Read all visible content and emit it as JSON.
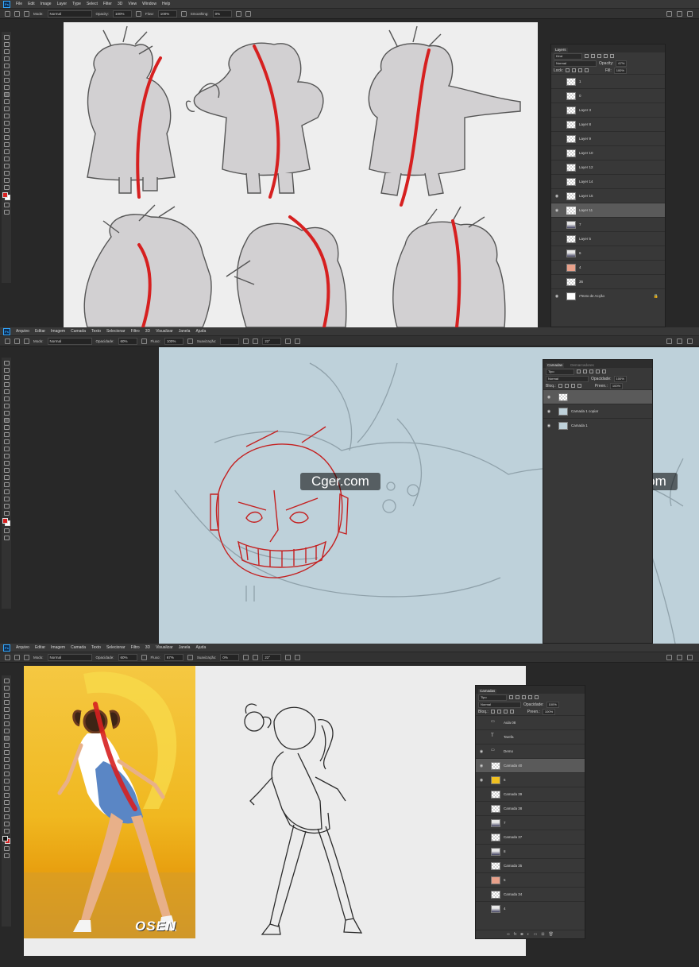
{
  "colors": {
    "ui_dark": "#282828",
    "ui_panel": "#383838",
    "canvas_light": "#eeeeee",
    "canvas_blue": "#bed1da",
    "accent_red": "#d62020",
    "photo_yellow": "#f2c120"
  },
  "panel1": {
    "menu": [
      "File",
      "Edit",
      "Image",
      "Layer",
      "Type",
      "Select",
      "Filter",
      "3D",
      "View",
      "Window",
      "Help"
    ],
    "options": {
      "mode_label": "Mode:",
      "mode_value": "Normal",
      "opacity_label": "Opacity:",
      "opacity_value": "100%",
      "flow_label": "Flow:",
      "flow_value": "100%",
      "smoothing_label": "Smoothing:",
      "smoothing_value": "0%"
    },
    "layers": {
      "title": "Layers",
      "filter": "Kind",
      "blend": "Normal",
      "opacity_label": "Opacity:",
      "opacity_value": "67%",
      "lock_label": "Lock:",
      "fill_label": "Fill:",
      "fill_value": "100%",
      "items": [
        {
          "name": "1",
          "thumb": "check"
        },
        {
          "name": "0",
          "thumb": "check"
        },
        {
          "name": "Layer 3",
          "thumb": "check"
        },
        {
          "name": "Layer 8",
          "thumb": "check"
        },
        {
          "name": "Layer 9",
          "thumb": "check"
        },
        {
          "name": "Layer 10",
          "thumb": "check"
        },
        {
          "name": "Layer 12",
          "thumb": "check"
        },
        {
          "name": "Layer 14",
          "thumb": "check"
        },
        {
          "name": "Layer 15",
          "thumb": "check",
          "visible": true
        },
        {
          "name": "Layer 11",
          "thumb": "sketch",
          "visible": true,
          "selected": true
        },
        {
          "name": "7",
          "thumb": "figure"
        },
        {
          "name": "Layer 5",
          "thumb": "check"
        },
        {
          "name": "6",
          "thumb": "figure"
        },
        {
          "name": "4",
          "thumb": "pink"
        },
        {
          "name": "36",
          "thumb": "check"
        },
        {
          "name": "rTexto de Acção",
          "thumb": "plain",
          "visible": true,
          "locked": true
        }
      ]
    }
  },
  "panel2": {
    "menu": [
      "Arquivo",
      "Editar",
      "Imagem",
      "Camada",
      "Texto",
      "Selecionar",
      "Filtro",
      "3D",
      "Visualizar",
      "Janela",
      "Ajuda"
    ],
    "options": {
      "mode_label": "Modo:",
      "mode_value": "Normal",
      "opacity_label": "Opacidade:",
      "opacity_value": "60%",
      "flow_label": "Fluxo:",
      "flow_value": "100%",
      "smoothing_label": "Suavização:",
      "angle_value": "22°"
    },
    "layers": {
      "tabs": [
        "Camadas",
        "Demarcadores"
      ],
      "filter": "Tipo",
      "blend": "Normal",
      "opacity_label": "Opacidade:",
      "opacity_value": "100%",
      "lock_label": "Bloq.:",
      "fill_label": "Preen.:",
      "fill_value": "100%",
      "items": [
        {
          "name": "",
          "thumb": "check",
          "visible": true,
          "selected": true
        },
        {
          "name": "Camada 1 copiar",
          "thumb": "blue",
          "visible": true
        },
        {
          "name": "Camada 1",
          "thumb": "blue",
          "visible": true
        }
      ]
    },
    "watermarks": [
      "Cger.com",
      "Cger.com"
    ]
  },
  "panel3": {
    "menu": [
      "Arquivo",
      "Editar",
      "Imagem",
      "Camada",
      "Texto",
      "Selecionar",
      "Filtro",
      "3D",
      "Visualizar",
      "Janela",
      "Ajuda"
    ],
    "options": {
      "mode_label": "Modo:",
      "mode_value": "Normal",
      "opacity_label": "Opacidade:",
      "opacity_value": "60%",
      "flow_label": "Fluxo:",
      "flow_value": "67%",
      "smoothing_label": "Suavização:",
      "smoothing_value": "0%",
      "angle_value": "22°"
    },
    "photo_label": "OSEN",
    "layers": {
      "title": "Camadas",
      "filter": "Tipo",
      "blend": "Normal",
      "opacity_label": "Opacidade:",
      "opacity_value": "100%",
      "lock_label": "Bloq.:",
      "fill_label": "Preen.:",
      "fill_value": "100%",
      "items": [
        {
          "name": "Aula 08",
          "thumb": "folder"
        },
        {
          "name": "Tarefa",
          "thumb": "text"
        },
        {
          "name": "Demo",
          "thumb": "folder",
          "visible": true
        },
        {
          "name": "Camada 40",
          "thumb": "check",
          "visible": true,
          "selected": true
        },
        {
          "name": "6",
          "thumb": "yellow",
          "visible": true
        },
        {
          "name": "Camada 39",
          "thumb": "check"
        },
        {
          "name": "Camada 38",
          "thumb": "check"
        },
        {
          "name": "7",
          "thumb": "figure"
        },
        {
          "name": "Camada 37",
          "thumb": "check"
        },
        {
          "name": "8",
          "thumb": "figure"
        },
        {
          "name": "Camada 35",
          "thumb": "check"
        },
        {
          "name": "5",
          "thumb": "pink"
        },
        {
          "name": "Camada 34",
          "thumb": "check"
        },
        {
          "name": "4",
          "thumb": "figure"
        }
      ]
    }
  }
}
